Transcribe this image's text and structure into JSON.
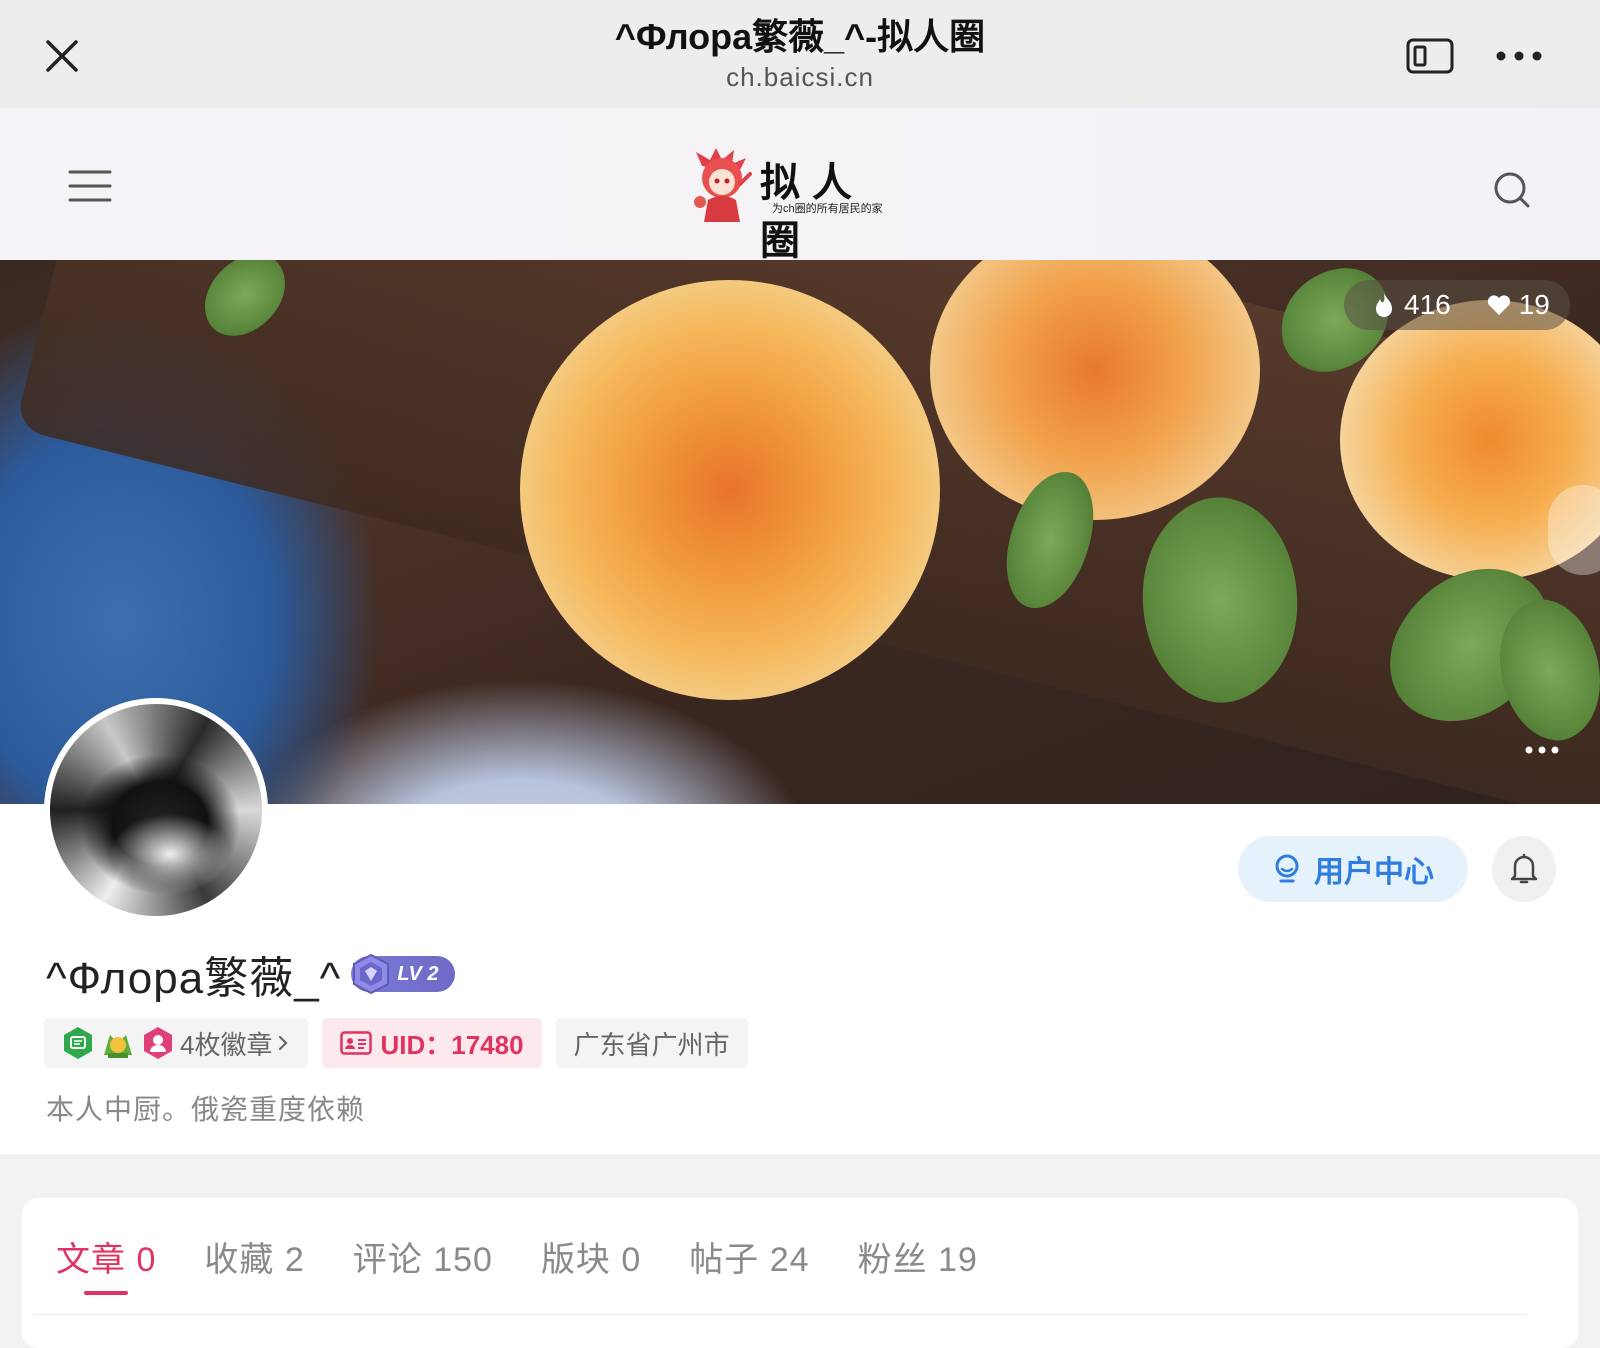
{
  "browser": {
    "title": "^Флора繁薇_^-拟人圈",
    "url": "ch.baicsi.cn"
  },
  "site": {
    "name": "拟人圈",
    "tagline": "为ch圈的所有居民的家"
  },
  "banner": {
    "hot_count": "416",
    "like_count": "19"
  },
  "profile": {
    "username": "^Флора繁薇_^",
    "level": "LV 2",
    "badges_label": "4枚徽章",
    "uid_label": "UID：17480",
    "location": "广东省广州市",
    "bio": "本人中厨。俄瓷重度依赖",
    "user_center_label": "用户中心"
  },
  "tabs": [
    {
      "label": "文章",
      "count": "0",
      "active": true
    },
    {
      "label": "收藏",
      "count": "2",
      "active": false
    },
    {
      "label": "评论",
      "count": "150",
      "active": false
    },
    {
      "label": "版块",
      "count": "0",
      "active": false
    },
    {
      "label": "帖子",
      "count": "24",
      "active": false
    },
    {
      "label": "粉丝",
      "count": "19",
      "active": false
    }
  ],
  "colors": {
    "accent": "#e0335f",
    "blue": "#2f7de0",
    "level": "#6e6ac6"
  }
}
